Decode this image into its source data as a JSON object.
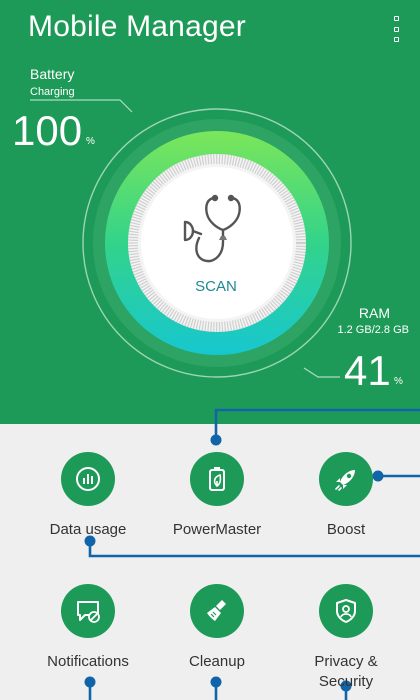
{
  "app": {
    "title": "Mobile Manager",
    "accent_color": "#1e9a58",
    "menu_icon": "more-vert-icon"
  },
  "battery": {
    "label": "Battery",
    "status": "Charging",
    "value": "100",
    "unit": "%"
  },
  "ram": {
    "label": "RAM",
    "usage": "1.2 GB/2.8 GB",
    "value": "41",
    "unit": "%"
  },
  "scan": {
    "label": "SCAN",
    "icon": "stethoscope-icon",
    "label_color": "#1d8a8e"
  },
  "tiles": [
    {
      "label": "Data usage",
      "icon": "bar-chart-icon"
    },
    {
      "label": "PowerMaster",
      "icon": "battery-leaf-icon"
    },
    {
      "label": "Boost",
      "icon": "rocket-icon"
    },
    {
      "label": "Notifications",
      "icon": "message-blocked-icon"
    },
    {
      "label": "Cleanup",
      "icon": "broom-icon"
    },
    {
      "label": "Privacy &\nSecurity",
      "icon": "user-shield-icon"
    }
  ],
  "connector_color": "#1264a8"
}
